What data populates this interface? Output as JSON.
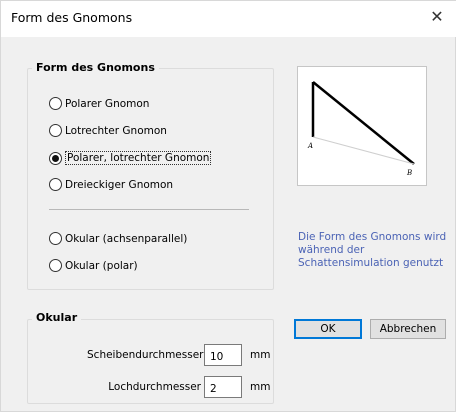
{
  "window": {
    "title": "Form des Gnomons"
  },
  "gnomon_group": {
    "legend": "Form des Gnomons",
    "options": [
      {
        "label": "Polarer Gnomon",
        "checked": false
      },
      {
        "label": "Lotrechter Gnomon",
        "checked": false
      },
      {
        "label": "Polarer, lotrechter Gnomon",
        "checked": true
      },
      {
        "label": "Dreieckiger Gnomon",
        "checked": false
      },
      {
        "label": "Okular (achsenparallel)",
        "checked": false
      },
      {
        "label": "Okular (polar)",
        "checked": false
      }
    ]
  },
  "preview": {
    "point_a": "A",
    "point_b": "B"
  },
  "info_text": "Die Form des Gnomons wird während der Schattensimulation genutzt",
  "okular_group": {
    "legend": "Okular",
    "fields": [
      {
        "label": "Scheibendurchmesser",
        "value": "10",
        "unit": "mm"
      },
      {
        "label": "Lochdurchmesser",
        "value": "2",
        "unit": "mm"
      }
    ]
  },
  "buttons": {
    "ok": "OK",
    "cancel": "Abbrechen"
  },
  "colors": {
    "info_text": "#4b63b5",
    "default_button_border": "#0078d7"
  }
}
